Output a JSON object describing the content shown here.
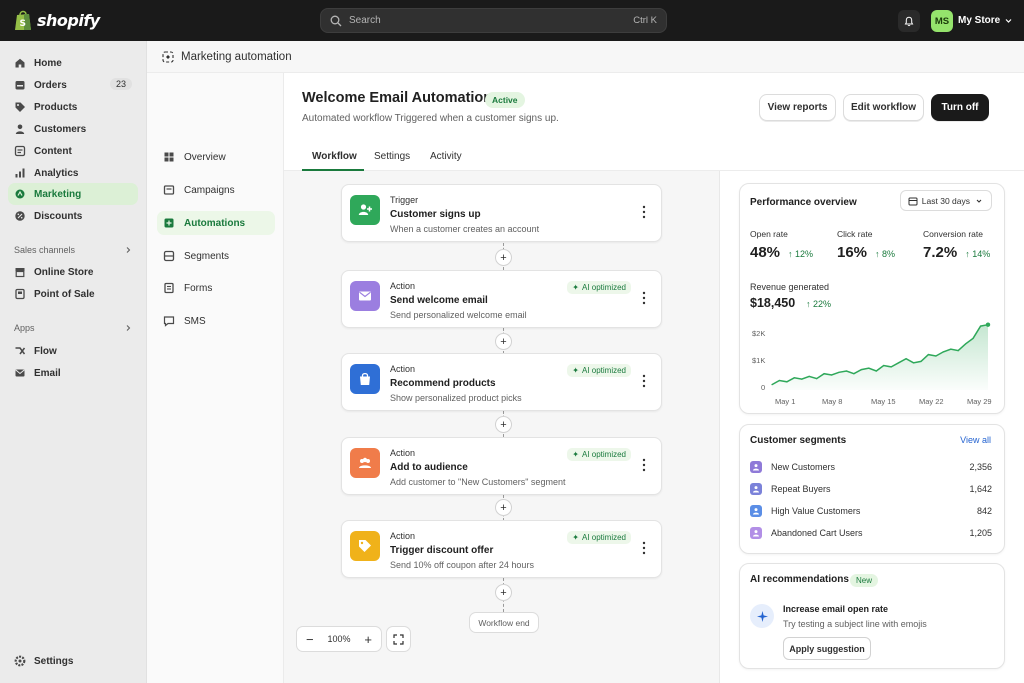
{
  "topbar": {
    "brand": "shopify",
    "search_placeholder": "Search",
    "search_shortcut": "Ctrl K",
    "avatar_initials": "MS",
    "store_name": "My Store"
  },
  "sidebar": {
    "items": [
      {
        "label": "Home",
        "icon": "home-icon"
      },
      {
        "label": "Orders",
        "icon": "orders-icon",
        "badge": "23"
      },
      {
        "label": "Products",
        "icon": "tag-icon"
      },
      {
        "label": "Customers",
        "icon": "person-icon"
      },
      {
        "label": "Content",
        "icon": "content-icon"
      },
      {
        "label": "Analytics",
        "icon": "analytics-icon"
      },
      {
        "label": "Marketing",
        "icon": "marketing-icon",
        "active": true
      },
      {
        "label": "Discounts",
        "icon": "discount-icon"
      }
    ],
    "sales_channels_label": "Sales channels",
    "sales_channels": [
      {
        "label": "Online Store"
      },
      {
        "label": "Point of Sale"
      }
    ],
    "apps_label": "Apps",
    "apps": [
      {
        "label": "Flow"
      },
      {
        "label": "Email"
      }
    ],
    "settings_label": "Settings"
  },
  "subnav": {
    "header": "Marketing automation",
    "items": [
      {
        "label": "Overview"
      },
      {
        "label": "Campaigns"
      },
      {
        "label": "Automations",
        "active": true
      },
      {
        "label": "Segments"
      },
      {
        "label": "Forms"
      },
      {
        "label": "SMS"
      }
    ]
  },
  "page": {
    "title": "Welcome Email Automation",
    "status": "Active",
    "subtitle": "Automated workflow Triggered when a customer signs up.",
    "buttons": {
      "view_reports": "View reports",
      "edit_workflow": "Edit workflow",
      "turn_off": "Turn off"
    },
    "tabs": [
      {
        "label": "Workflow",
        "active": true
      },
      {
        "label": "Settings"
      },
      {
        "label": "Activity"
      }
    ]
  },
  "workflow": {
    "nodes": [
      {
        "kind": "Trigger",
        "title": "Customer signs up",
        "desc": "When a customer creates an account",
        "color": "#2fa85a",
        "icon": "person-add-icon"
      },
      {
        "kind": "Action",
        "title": "Send welcome email",
        "desc": "Send personalized welcome email",
        "color": "#9b7ee0",
        "icon": "mail-icon",
        "ai": "AI optimized"
      },
      {
        "kind": "Action",
        "title": "Recommend products",
        "desc": "Show personalized product picks",
        "color": "#2f6fd6",
        "icon": "shopping-bag-icon",
        "ai": "AI optimized"
      },
      {
        "kind": "Action",
        "title": "Add to audience",
        "desc": "Add customer to \"New Customers\" segment",
        "color": "#f07c4a",
        "icon": "people-icon",
        "ai": "AI optimized"
      },
      {
        "kind": "Action",
        "title": "Trigger discount offer",
        "desc": "Send 10% off coupon after 24 hours",
        "color": "#f0b21a",
        "icon": "discount-tag-icon",
        "ai": "AI optimized"
      }
    ],
    "end_label": "Workflow end",
    "zoom": "100%"
  },
  "performance": {
    "title": "Performance overview",
    "range": "Last 30 days",
    "metrics": [
      {
        "label": "Open rate",
        "value": "48%",
        "change": "12%"
      },
      {
        "label": "Click rate",
        "value": "16%",
        "change": "8%"
      },
      {
        "label": "Conversion rate",
        "value": "7.2%",
        "change": "14%"
      }
    ],
    "revenue_label": "Revenue generated",
    "revenue_value": "$18,450",
    "revenue_change": "22%"
  },
  "chart_data": {
    "type": "area",
    "x": [
      "May 1",
      "May 2",
      "May 3",
      "May 4",
      "May 5",
      "May 6",
      "May 7",
      "May 8",
      "May 9",
      "May 10",
      "May 11",
      "May 12",
      "May 13",
      "May 14",
      "May 15",
      "May 16",
      "May 17",
      "May 18",
      "May 19",
      "May 20",
      "May 21",
      "May 22",
      "May 23",
      "May 24",
      "May 25",
      "May 26",
      "May 27",
      "May 28",
      "May 29",
      "May 30"
    ],
    "values": [
      200,
      350,
      300,
      450,
      400,
      500,
      420,
      600,
      550,
      650,
      700,
      600,
      750,
      800,
      700,
      900,
      850,
      1000,
      1150,
      1000,
      1050,
      1300,
      1250,
      1400,
      1500,
      1450,
      1700,
      1900,
      2350,
      2400
    ],
    "ylim": [
      0,
      2500
    ],
    "yticks": [
      "0",
      "$1K",
      "$2K"
    ],
    "ytick_values": [
      0,
      1000,
      2000
    ],
    "xticks": [
      "May 1",
      "May 8",
      "May 15",
      "May 22",
      "May 29"
    ],
    "grid": false,
    "color": "#2fa85a"
  },
  "segments": {
    "title": "Customer segments",
    "view_all": "View all",
    "rows": [
      {
        "name": "New Customers",
        "count": "2,356",
        "color": "#8f7ad8"
      },
      {
        "name": "Repeat Buyers",
        "count": "1,642",
        "color": "#7b82d9"
      },
      {
        "name": "High Value Customers",
        "count": "842",
        "color": "#5b8ee6"
      },
      {
        "name": "Abandoned Cart Users",
        "count": "1,205",
        "color": "#b28fe6"
      }
    ]
  },
  "ai_recs": {
    "title": "AI recommendations",
    "badge": "New",
    "rec_title": "Increase email open rate",
    "rec_desc": "Try testing a subject line with emojis",
    "button": "Apply suggestion"
  }
}
